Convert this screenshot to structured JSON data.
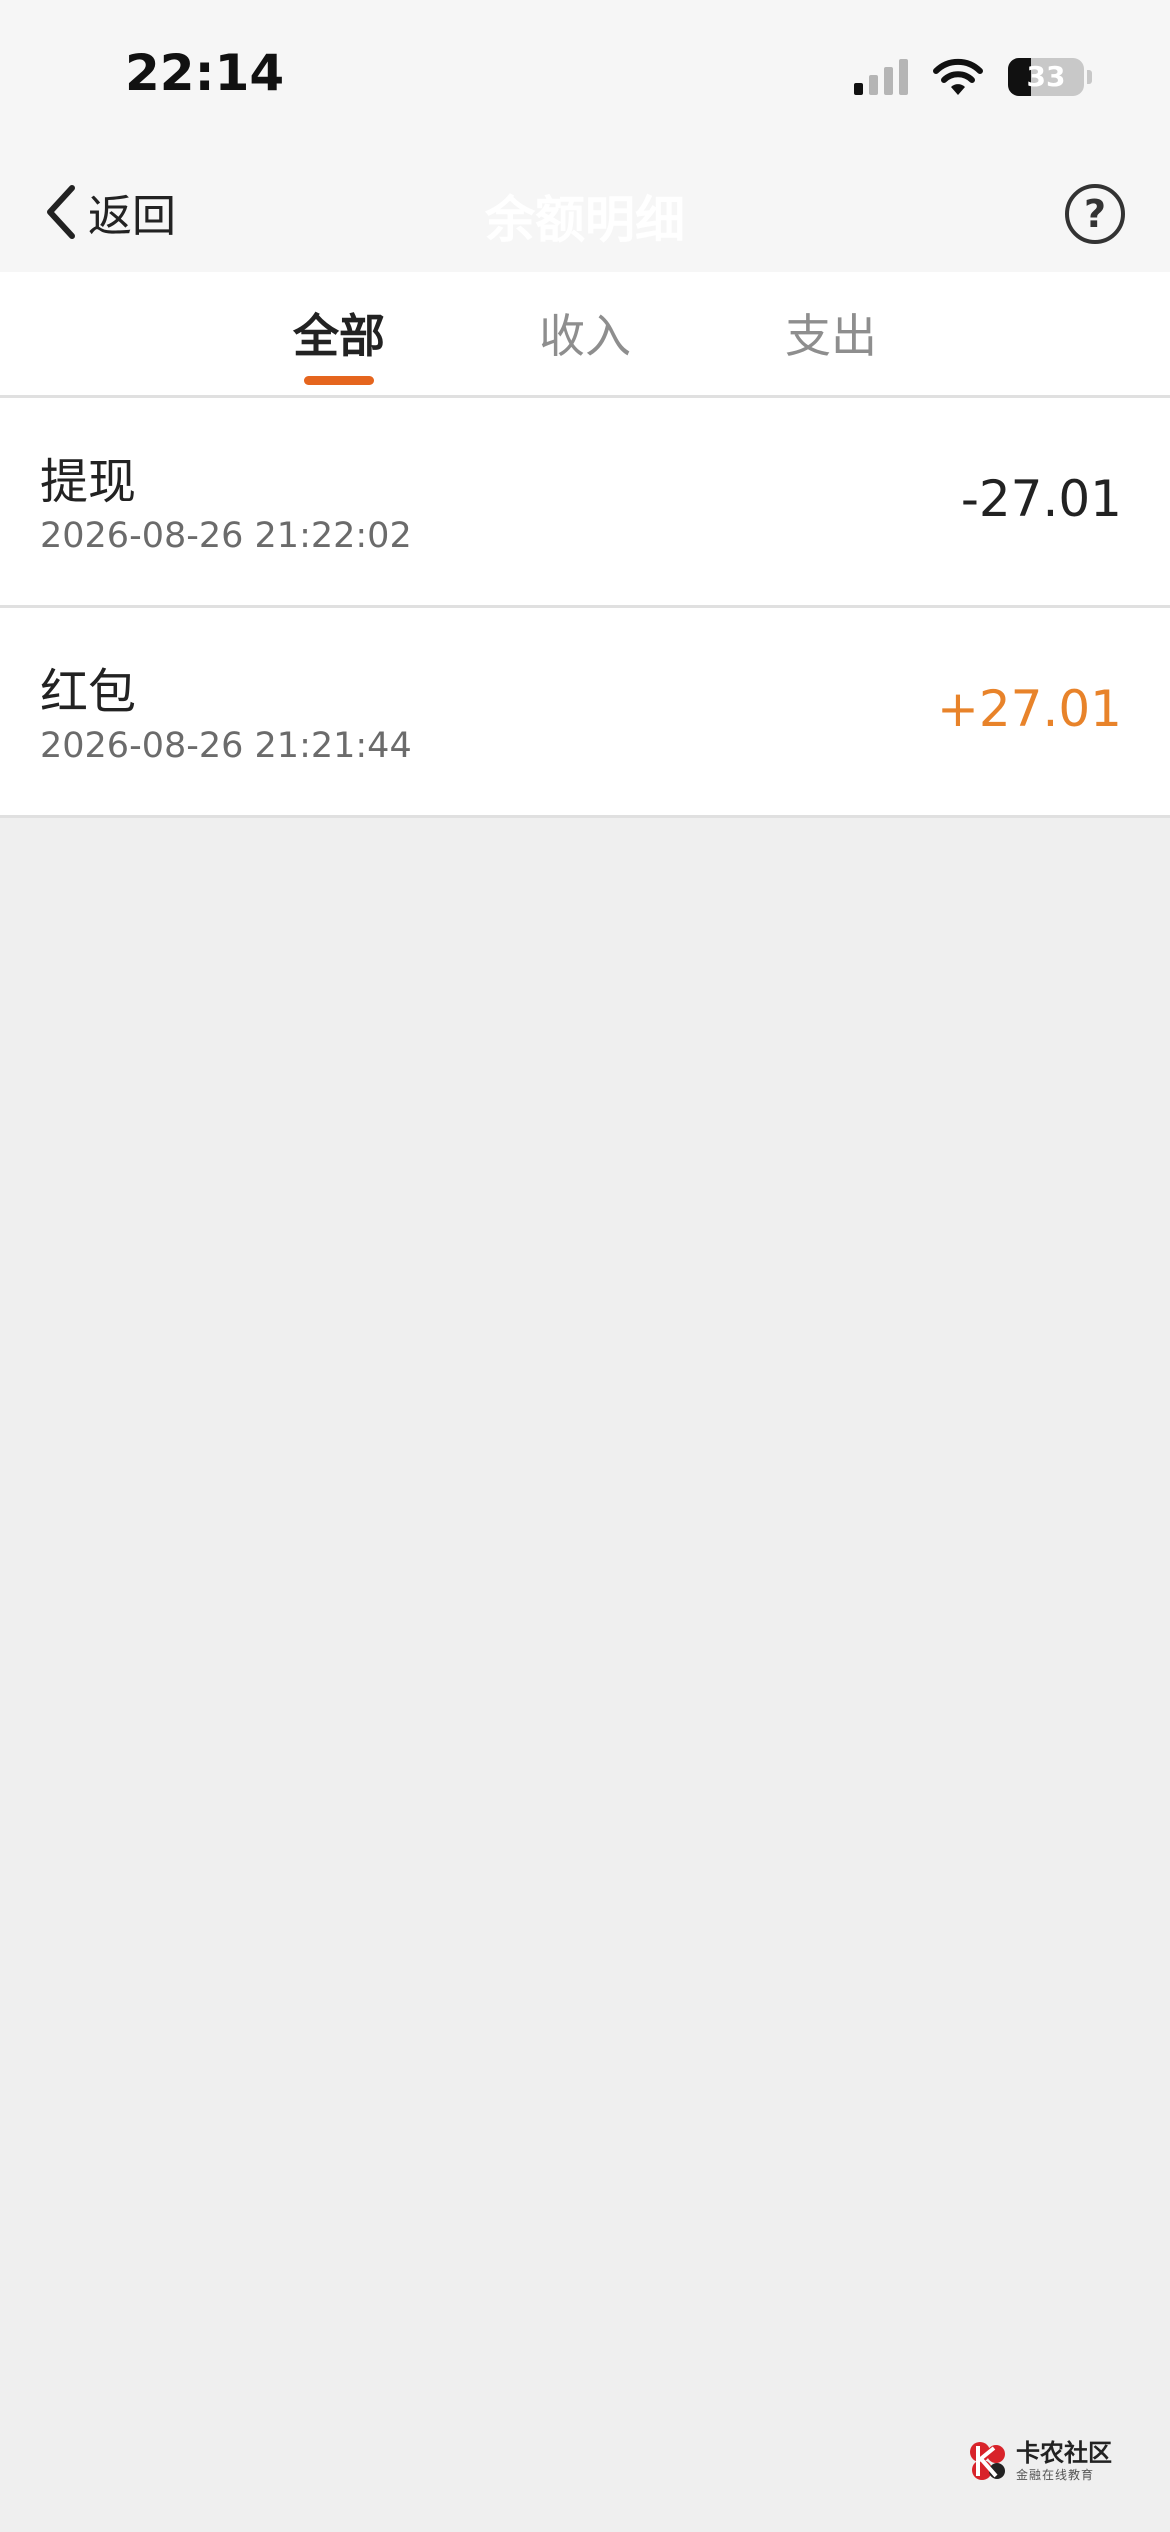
{
  "status_bar": {
    "time": "22:14",
    "battery_level": "33",
    "icons": [
      "cellular-signal-icon",
      "wifi-icon",
      "battery-icon"
    ]
  },
  "nav": {
    "back_label": "返回",
    "title": "余额明细",
    "help_label": "?",
    "title_color": "#ffffff"
  },
  "tabs": [
    {
      "label": "全部",
      "active": true
    },
    {
      "label": "收入",
      "active": false
    },
    {
      "label": "支出",
      "active": false
    }
  ],
  "records": [
    {
      "title": "提现",
      "time": "2026-08-26 21:22:02",
      "amount": "-27.01",
      "amount_color": "#222222"
    },
    {
      "title": "红包",
      "time": "2026-08-26 21:21:44",
      "amount": "+27.01",
      "amount_color": "#e8832a"
    }
  ],
  "watermark": {
    "name": "卡农社区",
    "slogan": "金融在线教育",
    "logo_color": "#d8232a"
  },
  "colors": {
    "accent": "#e5651e",
    "income": "#e8832a",
    "background": "#efefef"
  }
}
